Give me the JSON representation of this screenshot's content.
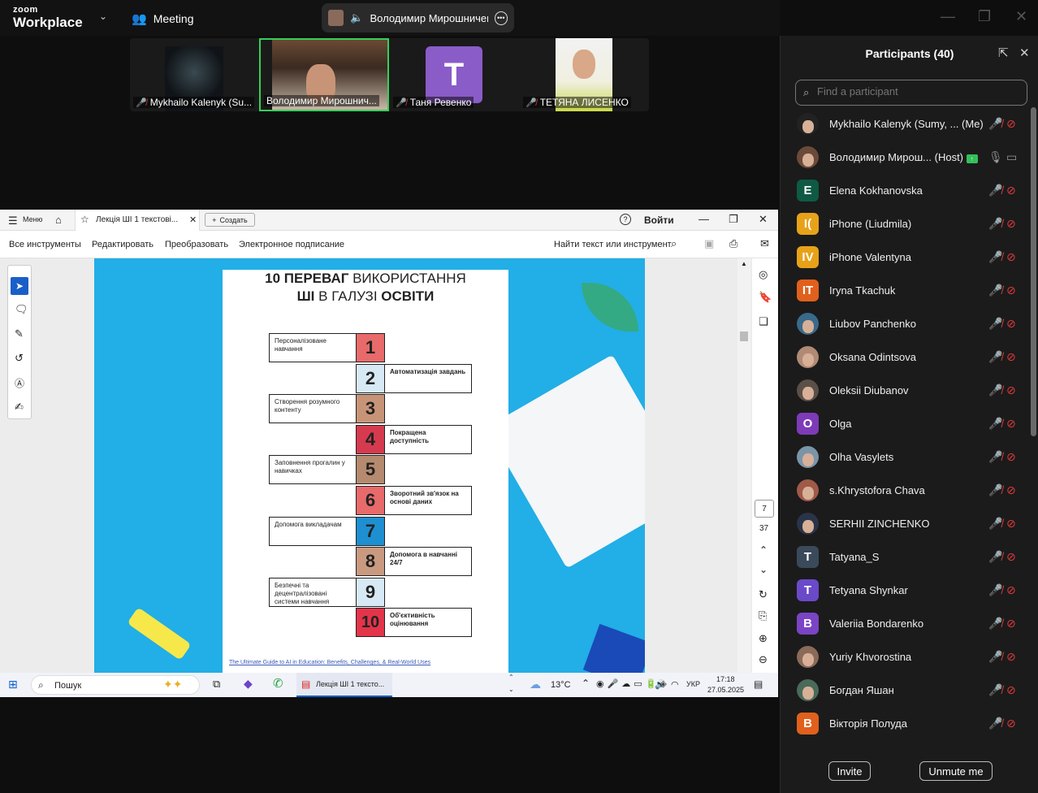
{
  "app": {
    "brand_small": "zoom",
    "brand_large": "Workplace",
    "meeting_label": "Meeting",
    "active_speaker": "Володимир Мирошниченко"
  },
  "thumbnails": [
    {
      "name": "Mykhailo Kalenyk (Su..."
    },
    {
      "name": "Володимир Мирошнич..."
    },
    {
      "name": "Таня Ревенко",
      "initial": "T"
    },
    {
      "name": "ТЕТЯНА ЛИСЕНКО"
    }
  ],
  "pdf": {
    "menu_label": "Меню",
    "tab_title": "Лекція ШІ 1 текстові...",
    "create_label": "Создать",
    "login_label": "Войти",
    "tools": [
      "Все инструменты",
      "Редактировать",
      "Преобразовать",
      "Электронное подписание"
    ],
    "find_label": "Найти текст или инструмент",
    "page_current": "7",
    "page_total": "37",
    "slide": {
      "title_line1_bold": "10 ПЕРЕВАГ",
      "title_line1_rest": " ВИКОРИСТАННЯ",
      "title_line2_bold": "ШІ",
      "title_line2_mid": " В ГАЛУЗІ ",
      "title_line2_end": "ОСВІТИ",
      "items": [
        {
          "n": "1",
          "text": "Персоналізоване навчання",
          "color": "#e86a6a"
        },
        {
          "n": "2",
          "text": "Автоматизація завдань",
          "color": "#d7e9f5"
        },
        {
          "n": "3",
          "text": "Створення розумного контенту",
          "color": "#c89478"
        },
        {
          "n": "4",
          "text": "Покращена доступність",
          "color": "#d63a4f"
        },
        {
          "n": "5",
          "text": "Заповнення прогалин у навичках",
          "color": "#b58a6e"
        },
        {
          "n": "6",
          "text": "Зворотний зв'язок на основі даних",
          "color": "#e86a6a"
        },
        {
          "n": "7",
          "text": "Допомога викладачам",
          "color": "#1e8fd0"
        },
        {
          "n": "8",
          "text": "Допомога в навчанні 24/7",
          "color": "#c99a80"
        },
        {
          "n": "9",
          "text": "Безпечні та децентралізовані системи навчання",
          "color": "#d7e9f5"
        },
        {
          "n": "10",
          "text": "Об'єктивність оцінювання",
          "color": "#e4344a"
        }
      ],
      "footer": "The Ultimate Guide to AI in Education: Benefits, Challenges, & Real-World Uses"
    }
  },
  "taskbar": {
    "search": "Пошук",
    "app_label": "Лекція ШІ 1 тексто...",
    "weather": "13°C",
    "lang": "УКР",
    "time": "17:18",
    "date": "27.05.2025"
  },
  "participants": {
    "title": "Participants (40)",
    "search_placeholder": "Find a participant",
    "list": [
      {
        "name": "Mykhailo Kalenyk (Sumy, ...",
        "tag": "(Me)",
        "avatar": "photo",
        "color": "#222"
      },
      {
        "name": "Володимир Мирош...",
        "tag": "(Host)",
        "avatar": "photo",
        "color": "#6b4a3a",
        "host": true
      },
      {
        "name": "Elena Kokhanovska",
        "avatar": "E",
        "color": "#0f5a44"
      },
      {
        "name": "iPhone (Liudmila)",
        "avatar": "I(",
        "color": "#e8a219"
      },
      {
        "name": "iPhone Valentyna",
        "avatar": "IV",
        "color": "#e8a219"
      },
      {
        "name": "Iryna Tkachuk",
        "avatar": "IT",
        "color": "#e0601c"
      },
      {
        "name": "Liubov Panchenko",
        "avatar": "photo",
        "color": "#3a6a8a"
      },
      {
        "name": "Oksana Odintsova",
        "avatar": "photo",
        "color": "#b08a74"
      },
      {
        "name": "Oleksii Diubanov",
        "avatar": "photo",
        "color": "#5a5048"
      },
      {
        "name": "Olga",
        "avatar": "O",
        "color": "#7d3bb8"
      },
      {
        "name": "Olha Vasylets",
        "avatar": "photo",
        "color": "#7a95a8"
      },
      {
        "name": "s.Khrystofora Chava",
        "avatar": "photo",
        "color": "#a05a48"
      },
      {
        "name": "SERHII ZINCHENKO",
        "avatar": "photo",
        "color": "#2a3448"
      },
      {
        "name": "Tatyana_S",
        "avatar": "T",
        "color": "#3a4a5a"
      },
      {
        "name": "Tetyana Shynkar",
        "avatar": "T",
        "color": "#6a4ac8"
      },
      {
        "name": "Valeriia Bondarenko",
        "avatar": "B",
        "color": "#7a44c4"
      },
      {
        "name": "Yuriy Khvorostina",
        "avatar": "photo",
        "color": "#8a6a58"
      },
      {
        "name": "Богдан Яшан",
        "avatar": "photo",
        "color": "#4a6a5a"
      },
      {
        "name": "Вікторія Полуда",
        "avatar": "B",
        "color": "#e0601c"
      }
    ],
    "invite_label": "Invite",
    "unmute_label": "Unmute me"
  }
}
